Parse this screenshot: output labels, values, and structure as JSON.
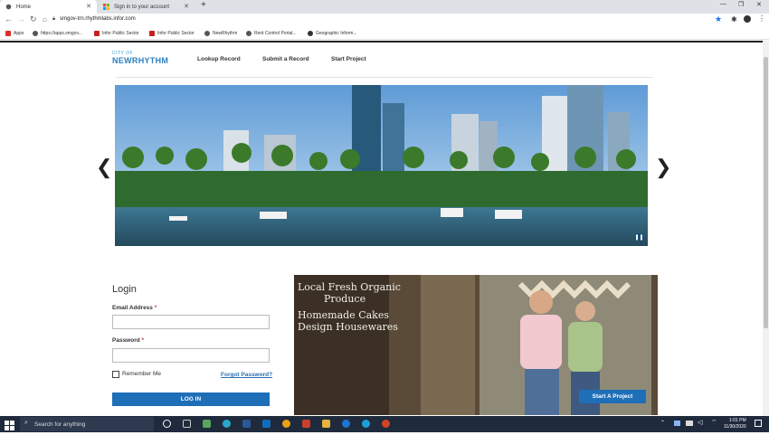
{
  "browser": {
    "tabs": [
      {
        "title": "Home",
        "active": true
      },
      {
        "title": "Sign in to your account",
        "active": false
      }
    ],
    "url": "smgov-trn.rhythmlabs.infor.com",
    "bookmarks": [
      {
        "label": "Apps",
        "color": "#d93025"
      },
      {
        "label": "https://apps.smgov...",
        "color": "#555555"
      },
      {
        "label": "Infor Public Sector",
        "color": "#c4201d"
      },
      {
        "label": "Infor Public Sector",
        "color": "#c4201d"
      },
      {
        "label": "NewRhythm",
        "color": "#555555"
      },
      {
        "label": "Rent Control Portal...",
        "color": "#555555"
      },
      {
        "label": "Geographic Inform...",
        "color": "#333333"
      }
    ]
  },
  "site": {
    "logo_top": "CITY OF",
    "logo_main": "NEWRHYTHM",
    "nav": [
      "Lookup Record",
      "Submit a Record",
      "Start Project"
    ]
  },
  "login": {
    "title": "Login",
    "email_label": "Email Address",
    "password_label": "Password",
    "required_mark": "*",
    "remember_label": "Remember Me",
    "forgot_label": "Forgot Password?",
    "button_label": "LOG IN"
  },
  "promo": {
    "sign_text": [
      "Local Fresh Organic",
      "Produce",
      "Homemade Cakes",
      "Design Housewares"
    ],
    "button_label": "Start A Project"
  },
  "taskbar": {
    "search_placeholder": "Search for anything",
    "time": "1:01 PM",
    "date": "11/30/2020"
  },
  "colors": {
    "accent": "#1e6eb8",
    "logo": "#2d7fbf"
  }
}
